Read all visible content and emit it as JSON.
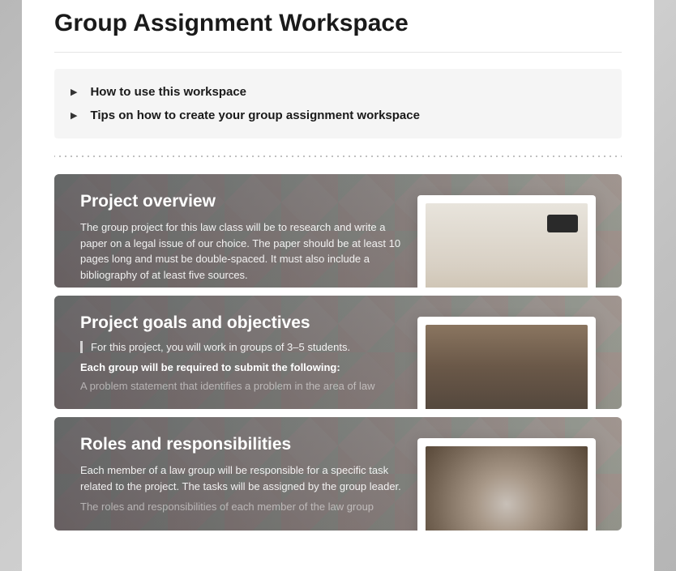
{
  "page": {
    "title": "Group Assignment Workspace"
  },
  "accordion": {
    "items": [
      {
        "label": "How to use this workspace"
      },
      {
        "label": "Tips on how to create your group assignment workspace"
      }
    ]
  },
  "cards": [
    {
      "title": "Project overview",
      "body": "The group project for this law class will be to research and write a paper on a legal issue of our choice. The paper should be at least 10 pages long and must be double-spaced. It must also include a bibliography of at least five sources.",
      "thumb": "desk"
    },
    {
      "title": "Project goals and objectives",
      "quote": "For this project, you will work in groups of 3–5 students.",
      "subhead": "Each group will be required to submit the following:",
      "fade": "A problem statement that identifies a problem in the area of law",
      "thumb": "meeting"
    },
    {
      "title": "Roles and responsibilities",
      "body": "Each member of a law group will be responsible for a specific task related to the project. The tasks will be assigned by the group leader.",
      "fade": "The roles and responsibilities of each member of the law group",
      "thumb": "hands"
    }
  ]
}
